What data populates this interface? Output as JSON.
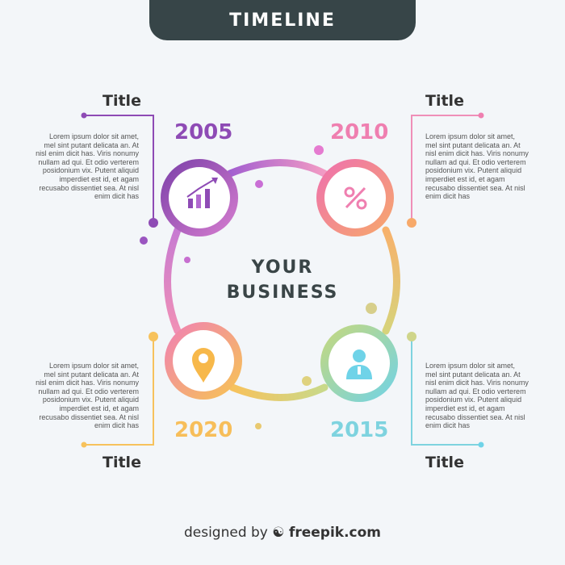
{
  "header": {
    "title": "TIMELINE"
  },
  "center": {
    "line1": "YOUR",
    "line2": "BUSINESS"
  },
  "milestones": [
    {
      "year": "2005",
      "title": "Title",
      "text": "Lorem ipsum dolor sit amet, mel sint putant delicata an. At nisl enim dicit has. Viris nonumy nullam ad qui. Et odio verterem posidonium vix. Putent aliquid imperdiet est id, et agam recusabo dissentiet sea. At nisl enim dicit has",
      "icon": "bar-chart-icon",
      "color": "#8e4bb5"
    },
    {
      "year": "2010",
      "title": "Title",
      "text": "Lorem ipsum dolor sit amet, mel sint putant delicata an. At nisl enim dicit has. Viris nonumy nullam ad qui. Et odio verterem posidonium vix. Putent aliquid imperdiet est id, et agam recusabo dissentiet sea. At nisl enim dicit has",
      "icon": "percent-icon",
      "color": "#ef7fb0"
    },
    {
      "year": "2020",
      "title": "Title",
      "text": "Lorem ipsum dolor sit amet, mel sint putant delicata an. At nisl enim dicit has. Viris nonumy nullam ad qui. Et odio verterem posidonium vix. Putent aliquid imperdiet est id, et agam recusabo dissentiet sea. At nisl enim dicit has",
      "icon": "location-pin-icon",
      "color": "#f7be5a"
    },
    {
      "year": "2015",
      "title": "Title",
      "text": "Lorem ipsum dolor sit amet, mel sint putant delicata an. At nisl enim dicit has. Viris nonumy nullam ad qui. Et odio verterem posidonium vix. Putent aliquid imperdiet est id, et agam recusabo dissentiet sea. At nisl enim dicit has",
      "icon": "person-icon",
      "color": "#7ed3df"
    }
  ],
  "footer": {
    "prefix": "designed by",
    "brand": "freepik.com"
  }
}
